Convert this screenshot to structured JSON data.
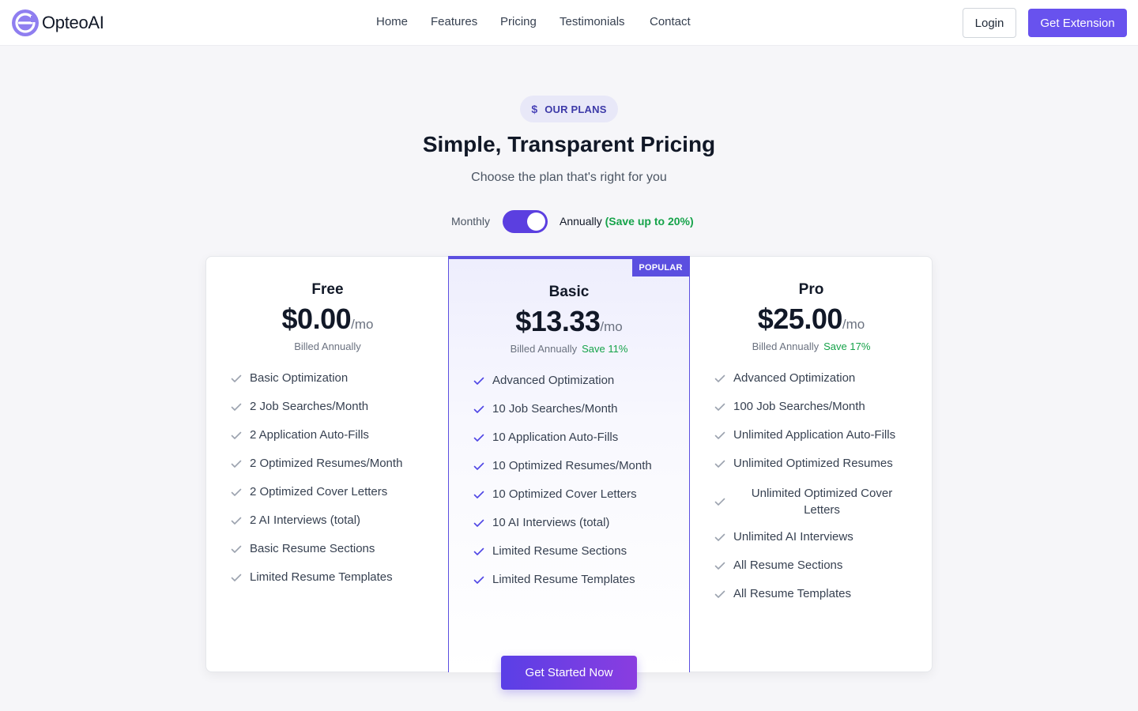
{
  "brand": {
    "name": "OpteoAI"
  },
  "nav": {
    "items": [
      "Home",
      "Features",
      "Pricing",
      "Testimonials",
      "Contact"
    ]
  },
  "header": {
    "login_label": "Login",
    "extension_label": "Get Extension"
  },
  "hero": {
    "badge": "OUR PLANS",
    "title": "Simple, Transparent Pricing",
    "subtitle": "Choose the plan that's right for you"
  },
  "billing": {
    "monthly_label": "Monthly",
    "annual_label": "Annually",
    "annual_save": "(Save up to 20%)",
    "annual_selected": true
  },
  "plans": [
    {
      "name": "Free",
      "price": "$0.00",
      "period": "/mo",
      "billed": "Billed Annually",
      "save": "",
      "features": [
        "Basic Optimization",
        "2 Job Searches/Month",
        "2 Application Auto-Fills",
        "2 Optimized Resumes/Month",
        "2 Optimized Cover Letters",
        "2 AI Interviews (total)",
        "Basic Resume Sections",
        "Limited Resume Templates"
      ]
    },
    {
      "name": "Basic",
      "price": "$13.33",
      "period": "/mo",
      "billed": "Billed Annually",
      "save": "Save 11%",
      "badge": "POPULAR",
      "features": [
        "Advanced Optimization",
        "10 Job Searches/Month",
        "10 Application Auto-Fills",
        "10 Optimized Resumes/Month",
        "10 Optimized Cover Letters",
        "10 AI Interviews (total)",
        "Limited Resume Sections",
        "Limited Resume Templates"
      ]
    },
    {
      "name": "Pro",
      "price": "$25.00",
      "period": "/mo",
      "billed": "Billed Annually",
      "save": "Save 17%",
      "features": [
        "Advanced Optimization",
        "100 Job Searches/Month",
        "Unlimited Application Auto-Fills",
        "Unlimited Optimized Resumes",
        "Unlimited Optimized Cover Letters",
        "Unlimited AI Interviews",
        "All Resume Sections",
        "All Resume Templates"
      ]
    }
  ],
  "cta": {
    "label": "Get Started Now"
  },
  "colors": {
    "accent": "#5b4fe0",
    "save_green": "#16a34a",
    "background": "#f6f6f9"
  },
  "icons": {
    "badge_icon": "dollar-icon",
    "feature_icon": "check-icon"
  }
}
